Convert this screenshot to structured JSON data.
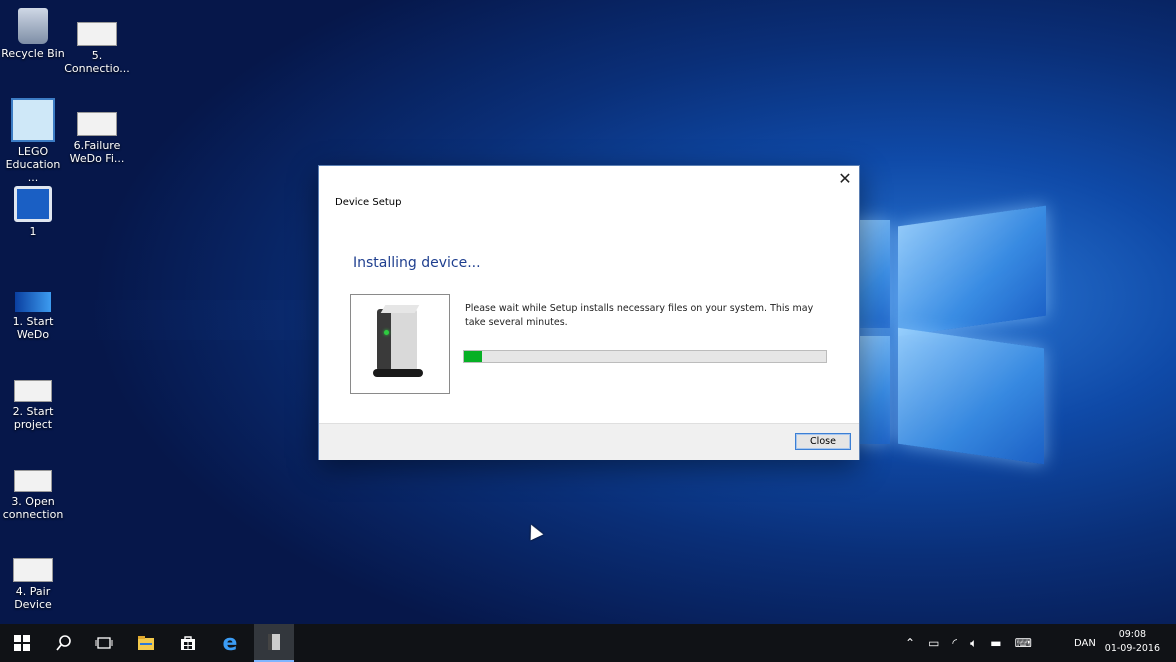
{
  "desktop": {
    "icons": [
      {
        "label": "Recycle Bin",
        "icon": "recycle-bin-icon"
      },
      {
        "label": "5.\nConnectio...",
        "icon": "shortcut-thumbnail-icon"
      },
      {
        "label": "LEGO\nEducation ...",
        "icon": "lego-education-icon"
      },
      {
        "label": "6.Failure\nWeDo Fi...",
        "icon": "shortcut-thumbnail-icon"
      },
      {
        "label": "1",
        "icon": "info-monitor-icon"
      },
      {
        "label": "1. Start WeDo",
        "icon": "shortcut-thumbnail-icon"
      },
      {
        "label": "2. Start\nproject",
        "icon": "shortcut-thumbnail-icon"
      },
      {
        "label": "3. Open\nconnection",
        "icon": "shortcut-thumbnail-icon"
      },
      {
        "label": "4. Pair Device",
        "icon": "shortcut-thumbnail-icon"
      }
    ]
  },
  "dialog": {
    "title": "Device Setup",
    "heading": "Installing device...",
    "message": "Please wait while Setup installs necessary files on your system. This may take several minutes.",
    "progress_fraction": 0.05,
    "progress_color": "#06b025",
    "close_button": "Close",
    "close_icon": "close-icon",
    "device_icon": "hard-drive-icon"
  },
  "taskbar": {
    "start_icon": "windows-start-icon",
    "search_icon": "search-icon",
    "taskview_icon": "task-view-icon",
    "explorer_icon": "file-explorer-icon",
    "store_icon": "store-icon",
    "edge_icon": "edge-icon",
    "active_app_icon": "device-setup-icon",
    "tray": {
      "language": "DAN",
      "time": "09:08",
      "date": "01-09-2016"
    }
  }
}
